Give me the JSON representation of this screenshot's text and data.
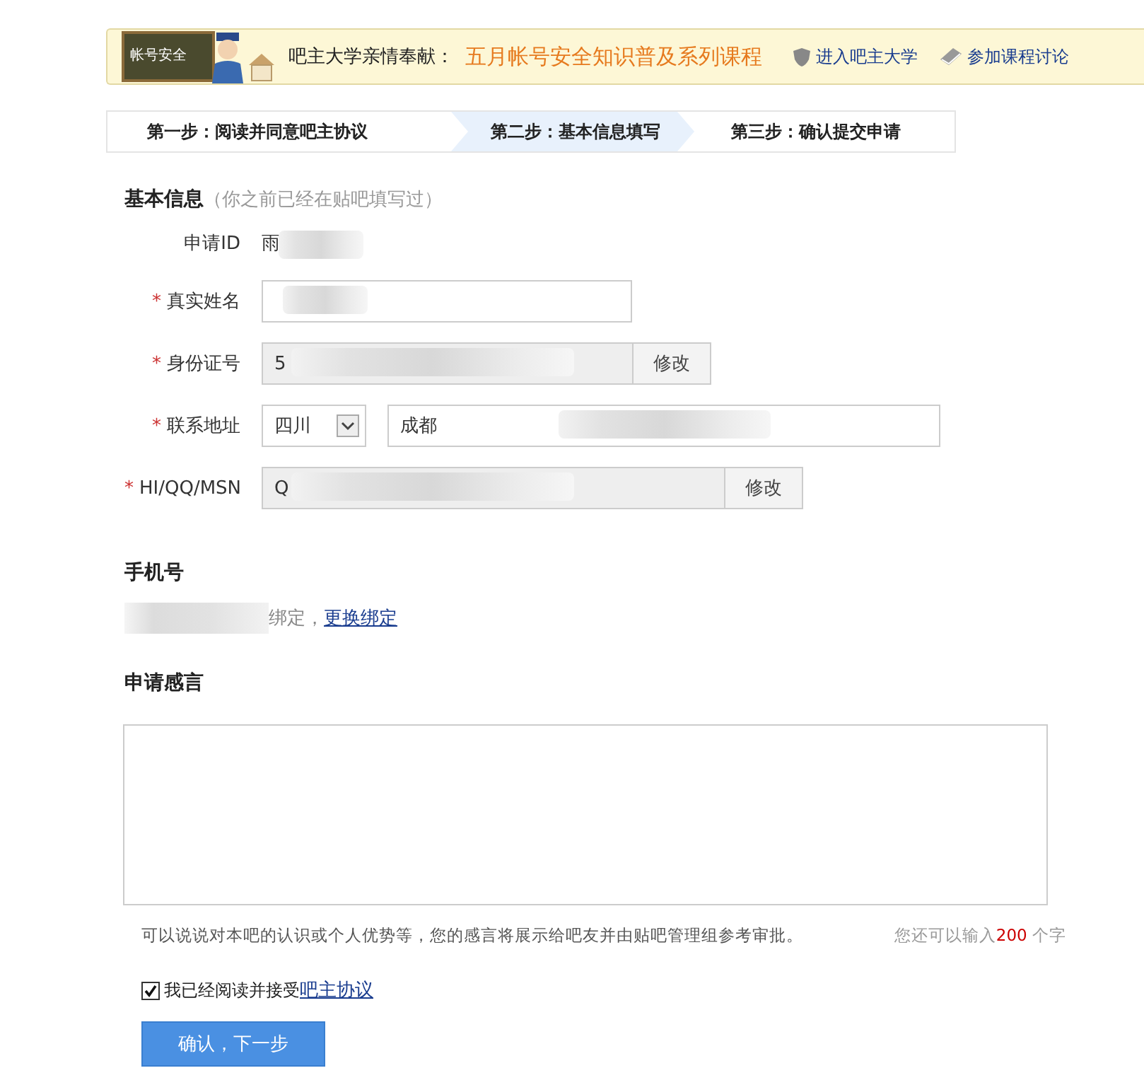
{
  "banner": {
    "board_text": "帐号安全",
    "intro": "吧主大学亲情奉献：",
    "headline": "五月帐号安全知识普及系列课程",
    "links": [
      {
        "kind": "shield",
        "label": "进入吧主大学"
      },
      {
        "kind": "book",
        "label": "参加课程讨论"
      }
    ]
  },
  "steps": [
    {
      "label": "第一步：阅读并同意吧主协议",
      "selected": false
    },
    {
      "label": "第二步：基本信息填写",
      "selected": true
    },
    {
      "label": "第三步：确认提交申请",
      "selected": false
    }
  ],
  "basic_info": {
    "title": "基本信息",
    "note": "（你之前已经在贴吧填写过）",
    "fields": [
      {
        "kind": "static",
        "label": "申请ID",
        "value": "雨",
        "redacted": true
      },
      {
        "kind": "text",
        "label": "真实姓名",
        "marker": "*",
        "redacted": true
      },
      {
        "kind": "locked",
        "label": "身份证号",
        "marker": "*",
        "value": "5",
        "button": "修改",
        "redacted": true
      },
      {
        "kind": "address",
        "label": "联系地址",
        "marker": "*",
        "select": "四川",
        "value": "成都",
        "redacted": true
      },
      {
        "kind": "locked",
        "label": "HI/QQ/MSN",
        "marker": "*",
        "value": "Q",
        "button": "修改",
        "redacted": true
      }
    ]
  },
  "phone": {
    "title": "手机号",
    "redacted": true,
    "text": "绑定，",
    "link": "更换绑定"
  },
  "statement": {
    "title": "申请感言",
    "hint": "可以说说对本吧的认识或个人优势等，您的感言将展示给吧友并由贴吧管理组参考审批。",
    "counter_prefix": "您还可以输入",
    "counter_number": "200",
    "counter_suffix": "个字"
  },
  "agreement": {
    "checked": true,
    "text": "我已经阅读并接受",
    "link": "吧主协议"
  },
  "submit": "确认，下一步"
}
